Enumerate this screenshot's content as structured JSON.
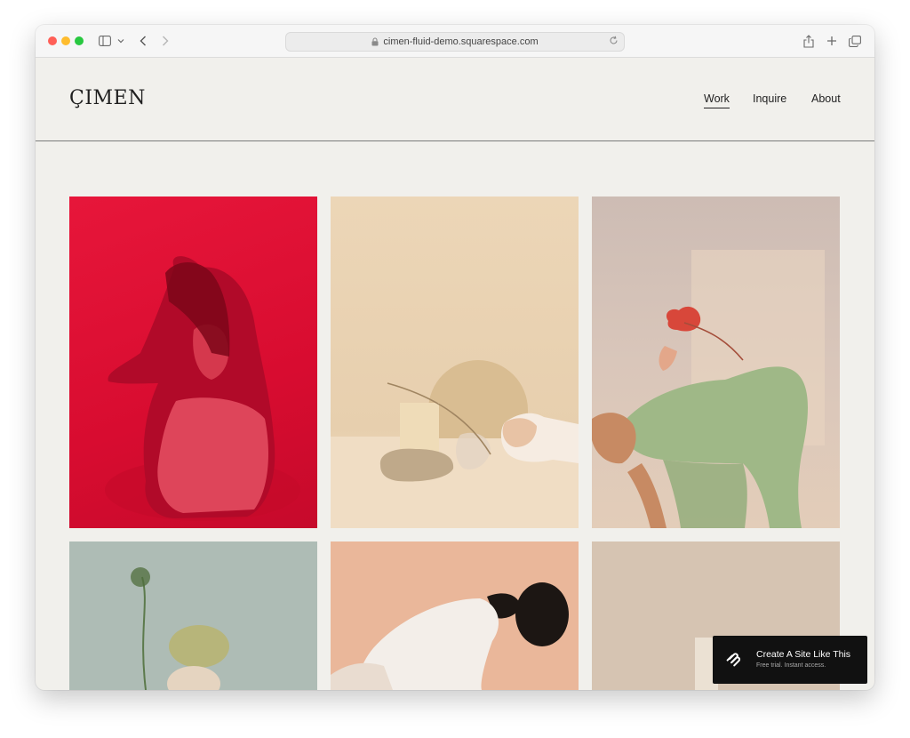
{
  "browser": {
    "url": "cimen-fluid-demo.squarespace.com"
  },
  "site": {
    "logo": "ÇIMEN",
    "nav": [
      {
        "label": "Work",
        "active": true
      },
      {
        "label": "Inquire",
        "active": false
      },
      {
        "label": "About",
        "active": false
      }
    ]
  },
  "gallery": {
    "tiles": [
      {
        "subject": "woman crouching in red light",
        "color": "#dc0f33"
      },
      {
        "subject": "still life with dried grass, stone and arch",
        "color": "#e9d3b4"
      },
      {
        "subject": "figure in green bending with anthurium",
        "color": "#d6c3b7"
      },
      {
        "subject": "cactus pear with wildflower on sage",
        "color": "#aebcb5"
      },
      {
        "subject": "woman in white leaning back on peach",
        "color": "#eab79a"
      },
      {
        "subject": "glass on beige",
        "color": "#d6c4b2"
      }
    ]
  },
  "promo": {
    "title": "Create A Site Like This",
    "subtitle": "Free trial. Instant access.",
    "icon": "squarespace-logo-icon"
  },
  "colors": {
    "page_background": "#f1f0ec",
    "text": "#222222",
    "promo_background": "#111111"
  }
}
